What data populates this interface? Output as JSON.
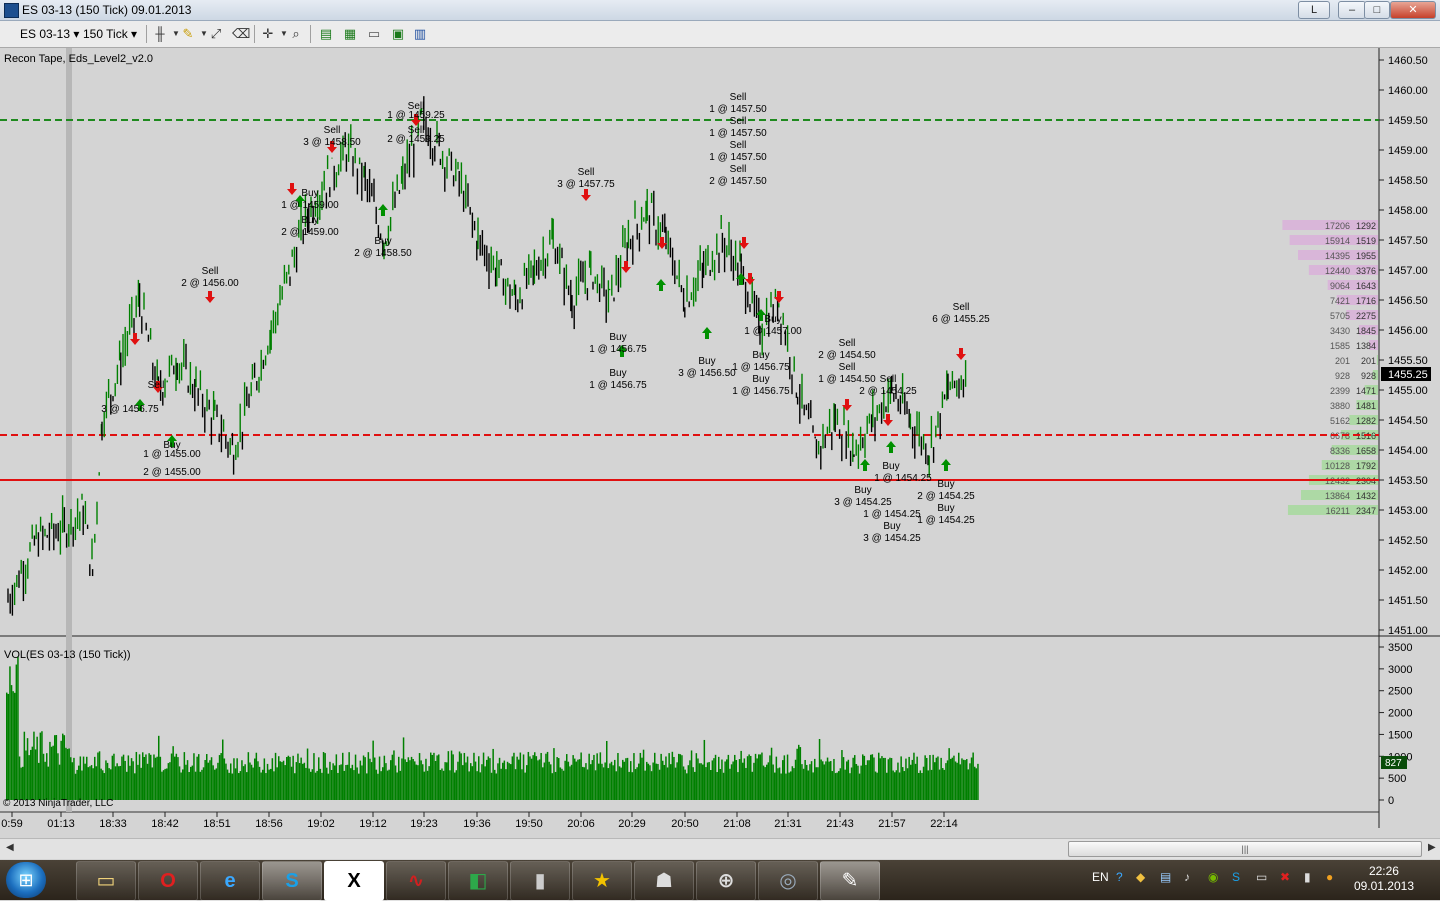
{
  "window": {
    "title": "ES 03-13 (150 Tick)  09.01.2013",
    "buttons": [
      "L",
      "–",
      "□",
      "✕"
    ]
  },
  "toolbar": {
    "instrument": "ES 03-13",
    "interval": "150 Tick"
  },
  "panels": {
    "price_label": "Recon Tape, Eds_Level2_v2.0",
    "volume_label": "VOL(ES 03-13 (150 Tick))",
    "copyright": "© 2013 NinjaTrader, LLC",
    "current_price": "1455.25",
    "current_volume": "827"
  },
  "colors": {
    "background": "#d4d4d4",
    "up_bar": "#008000",
    "down_bar": "#000000",
    "resistance_line": "#1f8a1f",
    "support_line": "#e01010",
    "buy_arrow": "#009000",
    "sell_arrow": "#e01010",
    "volume_bar": "#008000",
    "bid_profile": "#d9b3d9",
    "ask_profile": "#a9d9a0"
  },
  "taskbar": {
    "apps": [
      "explorer-icon",
      "opera-icon",
      "ie-icon",
      "skype-icon",
      "x-app-icon",
      "ninja-icon",
      "chart-app-icon",
      "tool-icon",
      "star-icon",
      "game-icon",
      "tank-icon",
      "steam-icon",
      "ninja-trader-icon"
    ],
    "language": "EN",
    "time": "22:26",
    "date": "09.01.2013"
  },
  "chart_data": {
    "type": "candlestick",
    "instrument": "ES 03-13",
    "interval": "150 Tick",
    "y_ticks": [
      "1460.50",
      "1460.00",
      "1459.50",
      "1459.00",
      "1458.50",
      "1458.00",
      "1457.50",
      "1457.00",
      "1456.50",
      "1456.00",
      "1455.50",
      "1455.00",
      "1454.50",
      "1454.00",
      "1453.50",
      "1453.00",
      "1452.50",
      "1452.00",
      "1451.50",
      "1451.00"
    ],
    "ylim": [
      1451.0,
      1460.5
    ],
    "x_ticks": [
      "0:59",
      "01:13",
      "18:33",
      "18:42",
      "18:51",
      "18:56",
      "19:02",
      "19:12",
      "19:23",
      "19:36",
      "19:50",
      "20:06",
      "20:29",
      "20:50",
      "21:08",
      "21:31",
      "21:43",
      "21:57",
      "22:14"
    ],
    "price_path": [
      [
        0,
        1451.5
      ],
      [
        3,
        1452.5
      ],
      [
        6,
        1452.7
      ],
      [
        8,
        1453.0
      ],
      [
        9,
        1452.0
      ],
      [
        10,
        1454.5
      ],
      [
        12,
        1455.5
      ],
      [
        14,
        1456.5
      ],
      [
        16,
        1455.0
      ],
      [
        18,
        1455.5
      ],
      [
        20,
        1455.0
      ],
      [
        22,
        1454.5
      ],
      [
        24,
        1454.0
      ],
      [
        26,
        1455.0
      ],
      [
        28,
        1456.0
      ],
      [
        30,
        1457.0
      ],
      [
        32,
        1458.0
      ],
      [
        34,
        1458.5
      ],
      [
        36,
        1459.0
      ],
      [
        38,
        1458.5
      ],
      [
        40,
        1457.5
      ],
      [
        42,
        1458.5
      ],
      [
        44,
        1459.5
      ],
      [
        46,
        1459.0
      ],
      [
        48,
        1458.5
      ],
      [
        50,
        1457.5
      ],
      [
        52,
        1457.0
      ],
      [
        54,
        1456.5
      ],
      [
        56,
        1457.0
      ],
      [
        58,
        1457.5
      ],
      [
        60,
        1456.5
      ],
      [
        62,
        1457.0
      ],
      [
        64,
        1456.5
      ],
      [
        66,
        1457.5
      ],
      [
        68,
        1458.0
      ],
      [
        70,
        1457.5
      ],
      [
        72,
        1456.5
      ],
      [
        74,
        1457.0
      ],
      [
        76,
        1457.5
      ],
      [
        78,
        1457.0
      ],
      [
        80,
        1456.0
      ],
      [
        82,
        1456.5
      ],
      [
        84,
        1455.0
      ],
      [
        86,
        1454.0
      ],
      [
        88,
        1454.5
      ],
      [
        90,
        1454.0
      ],
      [
        92,
        1454.5
      ],
      [
        94,
        1455.0
      ],
      [
        96,
        1454.5
      ],
      [
        98,
        1454.0
      ],
      [
        100,
        1455.0
      ],
      [
        102,
        1455.25
      ]
    ],
    "horizontal_levels": [
      {
        "price": 1459.5,
        "style": "dashed",
        "color": "#1f8a1f"
      },
      {
        "price": 1454.25,
        "style": "dashed",
        "color": "#e01010"
      },
      {
        "price": 1453.5,
        "style": "solid",
        "color": "#e01010"
      }
    ],
    "annotations": [
      {
        "text": "Sell",
        "price": 1459.75,
        "x": 416
      },
      {
        "text": "1 @ 1459.25",
        "price": 1459.6,
        "x": 416
      },
      {
        "text": "Sell",
        "price": 1459.35,
        "x": 416
      },
      {
        "text": "2 @ 1459.25",
        "price": 1459.2,
        "x": 416
      },
      {
        "text": "Sell",
        "price": 1459.9,
        "x": 738
      },
      {
        "text": "1 @ 1457.50",
        "price": 1459.7,
        "x": 738
      },
      {
        "text": "Sell",
        "price": 1459.5,
        "x": 738
      },
      {
        "text": "1 @ 1457.50",
        "price": 1459.3,
        "x": 738
      },
      {
        "text": "Sell",
        "price": 1459.1,
        "x": 738
      },
      {
        "text": "1 @ 1457.50",
        "price": 1458.9,
        "x": 738
      },
      {
        "text": "Sell",
        "price": 1458.7,
        "x": 738
      },
      {
        "text": "2 @ 1457.50",
        "price": 1458.5,
        "x": 738
      },
      {
        "text": "Sell",
        "price": 1458.65,
        "x": 586
      },
      {
        "text": "3 @ 1457.75",
        "price": 1458.45,
        "x": 586
      },
      {
        "text": "Sell",
        "price": 1457.0,
        "x": 210
      },
      {
        "text": "2 @ 1456.00",
        "price": 1456.8,
        "x": 210
      },
      {
        "text": "Sell",
        "price": 1459.35,
        "x": 332
      },
      {
        "text": "3 @ 1458.50",
        "price": 1459.15,
        "x": 332
      },
      {
        "text": "Buy",
        "price": 1458.3,
        "x": 310
      },
      {
        "text": "1 @ 1459.00",
        "price": 1458.1,
        "x": 310
      },
      {
        "text": "Buy",
        "price": 1457.85,
        "x": 310
      },
      {
        "text": "2 @ 1459.00",
        "price": 1457.65,
        "x": 310
      },
      {
        "text": "Buy",
        "price": 1457.5,
        "x": 383
      },
      {
        "text": "2 @ 1458.50",
        "price": 1457.3,
        "x": 383
      },
      {
        "text": "Sell",
        "price": 1455.1,
        "x": 156
      },
      {
        "text": "3 @ 1456.75",
        "price": 1454.7,
        "x": 130
      },
      {
        "text": "Buy",
        "price": 1454.1,
        "x": 172
      },
      {
        "text": "1 @ 1455.00",
        "price": 1453.95,
        "x": 172
      },
      {
        "text": "2 @ 1455.00",
        "price": 1453.65,
        "x": 172
      },
      {
        "text": "Buy",
        "price": 1455.9,
        "x": 618
      },
      {
        "text": "1 @ 1456.75",
        "price": 1455.7,
        "x": 618
      },
      {
        "text": "Buy",
        "price": 1455.3,
        "x": 618
      },
      {
        "text": "1 @ 1456.75",
        "price": 1455.1,
        "x": 618
      },
      {
        "text": "Buy",
        "price": 1455.5,
        "x": 707
      },
      {
        "text": "3 @ 1456.50",
        "price": 1455.3,
        "x": 707
      },
      {
        "text": "Buy",
        "price": 1456.2,
        "x": 773
      },
      {
        "text": "1 @ 1457.00",
        "price": 1456.0,
        "x": 773
      },
      {
        "text": "Buy",
        "price": 1455.6,
        "x": 761
      },
      {
        "text": "1 @ 1456.75",
        "price": 1455.4,
        "x": 761
      },
      {
        "text": "Buy",
        "price": 1455.2,
        "x": 761
      },
      {
        "text": "1 @ 1456.75",
        "price": 1455.0,
        "x": 761
      },
      {
        "text": "Sell",
        "price": 1455.8,
        "x": 847
      },
      {
        "text": "2 @ 1454.50",
        "price": 1455.6,
        "x": 847
      },
      {
        "text": "Sell",
        "price": 1455.4,
        "x": 847
      },
      {
        "text": "1 @ 1454.50",
        "price": 1455.2,
        "x": 847
      },
      {
        "text": "Sell",
        "price": 1455.2,
        "x": 888
      },
      {
        "text": "2 @ 1454.25",
        "price": 1455.0,
        "x": 888
      },
      {
        "text": "Sell",
        "price": 1456.4,
        "x": 961
      },
      {
        "text": "6 @ 1455.25",
        "price": 1456.2,
        "x": 961
      },
      {
        "text": "Buy",
        "price": 1453.75,
        "x": 891
      },
      {
        "text": "1 @ 1454.25",
        "price": 1453.55,
        "x": 903
      },
      {
        "text": "Buy",
        "price": 1453.35,
        "x": 863
      },
      {
        "text": "3 @ 1454.25",
        "price": 1453.15,
        "x": 863
      },
      {
        "text": "1 @ 1454.25",
        "price": 1452.95,
        "x": 892
      },
      {
        "text": "Buy",
        "price": 1452.75,
        "x": 892
      },
      {
        "text": "3 @ 1454.25",
        "price": 1452.55,
        "x": 892
      },
      {
        "text": "Buy",
        "price": 1453.45,
        "x": 946
      },
      {
        "text": "2 @ 1454.25",
        "price": 1453.25,
        "x": 946
      },
      {
        "text": "Buy",
        "price": 1453.05,
        "x": 946
      },
      {
        "text": "1 @ 1454.25",
        "price": 1452.85,
        "x": 946
      }
    ],
    "sell_arrows": [
      [
        416,
        1459.45
      ],
      [
        586,
        1458.2
      ],
      [
        210,
        1456.5
      ],
      [
        332,
        1459.0
      ],
      [
        292,
        1458.3
      ],
      [
        135,
        1455.8
      ],
      [
        158,
        1455.0
      ],
      [
        1418,
        1456.0
      ],
      [
        662,
        1457.4
      ],
      [
        744,
        1457.4
      ],
      [
        626,
        1457.0
      ],
      [
        750,
        1456.8
      ],
      [
        779,
        1456.5
      ],
      [
        847,
        1454.7
      ],
      [
        888,
        1454.45
      ],
      [
        961,
        1455.55
      ]
    ],
    "buy_arrows": [
      [
        383,
        1458.05
      ],
      [
        172,
        1454.2
      ],
      [
        622,
        1455.7
      ],
      [
        707,
        1456.0
      ],
      [
        661,
        1456.8
      ],
      [
        761,
        1456.3
      ],
      [
        741,
        1456.9
      ],
      [
        865,
        1453.8
      ],
      [
        891,
        1454.1
      ],
      [
        946,
        1453.8
      ],
      [
        300,
        1458.2
      ],
      [
        140,
        1454.8
      ]
    ],
    "profile": [
      {
        "price": 1457.75,
        "bid": "17206",
        "ask": "1292"
      },
      {
        "price": 1457.5,
        "bid": "15914",
        "ask": "1519"
      },
      {
        "price": 1457.25,
        "bid": "14395",
        "ask": "1955"
      },
      {
        "price": 1457.0,
        "bid": "12440",
        "ask": "3376"
      },
      {
        "price": 1456.75,
        "bid": "9064",
        "ask": "1643"
      },
      {
        "price": 1456.5,
        "bid": "7421",
        "ask": "1716"
      },
      {
        "price": 1456.25,
        "bid": "5705",
        "ask": "2275"
      },
      {
        "price": 1456.0,
        "bid": "3430",
        "ask": "1845"
      },
      {
        "price": 1455.75,
        "bid": "1585",
        "ask": "1384"
      },
      {
        "price": 1455.5,
        "bid": "201",
        "ask": "201"
      },
      {
        "price": 1455.25,
        "bid": "928",
        "ask": "928"
      },
      {
        "price": 1455.0,
        "bid": "2399",
        "ask": "1471"
      },
      {
        "price": 1454.75,
        "bid": "3880",
        "ask": "1481"
      },
      {
        "price": 1454.5,
        "bid": "5162",
        "ask": "1282"
      },
      {
        "price": 1454.25,
        "bid": "6678",
        "ask": "1516"
      },
      {
        "price": 1454.0,
        "bid": "8336",
        "ask": "1658"
      },
      {
        "price": 1453.75,
        "bid": "10128",
        "ask": "1792"
      },
      {
        "price": 1453.5,
        "bid": "12432",
        "ask": "2304"
      },
      {
        "price": 1453.25,
        "bid": "13864",
        "ask": "1432"
      },
      {
        "price": 1453.0,
        "bid": "16211",
        "ask": "2347"
      }
    ],
    "volume": {
      "y_ticks": [
        "3500",
        "3000",
        "2500",
        "2000",
        "1500",
        "1000",
        "500",
        "0"
      ],
      "ylim": [
        0,
        3500
      ],
      "last": 827
    }
  }
}
